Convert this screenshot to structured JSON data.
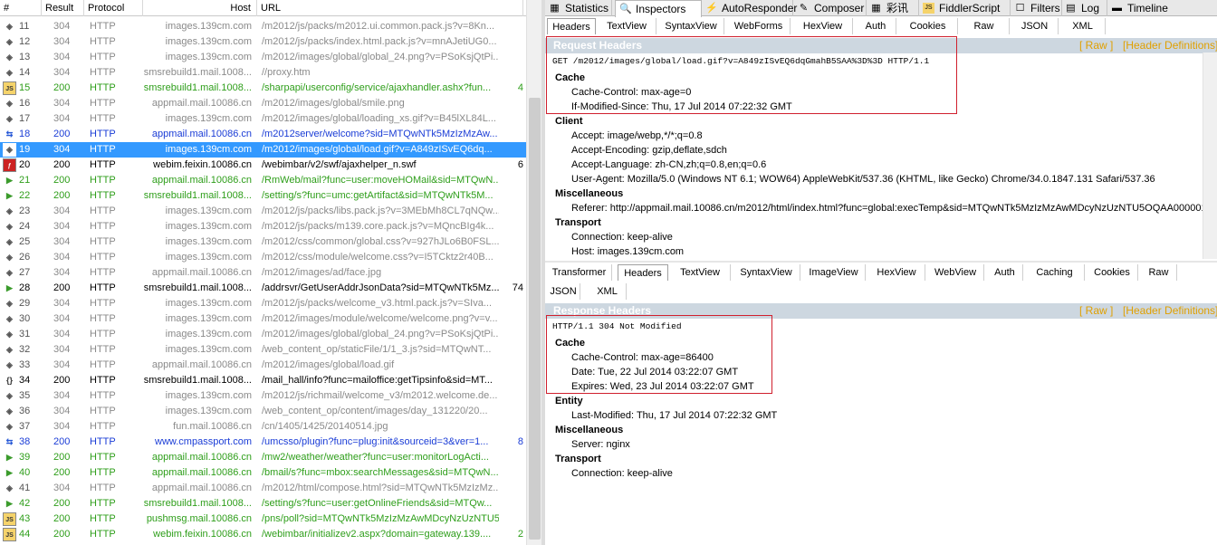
{
  "columns": {
    "num": "#",
    "result": "Result",
    "protocol": "Protocol",
    "host": "Host",
    "url": "URL"
  },
  "sessions": [
    {
      "icon": "img",
      "num": "11",
      "result": "304",
      "protocol": "HTTP",
      "host": "images.139cm.com",
      "url": "/m2012/js/packs/m2012.ui.common.pack.js?v=8Kn...",
      "size": "",
      "color": "gray"
    },
    {
      "icon": "img",
      "num": "12",
      "result": "304",
      "protocol": "HTTP",
      "host": "images.139cm.com",
      "url": "/m2012/js/packs/index.html.pack.js?v=mnAJetiUG0...",
      "size": "",
      "color": "gray"
    },
    {
      "icon": "img",
      "num": "13",
      "result": "304",
      "protocol": "HTTP",
      "host": "images.139cm.com",
      "url": "/m2012/images/global/global_24.png?v=PSoKsjQtPi...",
      "size": "",
      "color": "gray"
    },
    {
      "icon": "img",
      "num": "14",
      "result": "304",
      "protocol": "HTTP",
      "host": "smsrebuild1.mail.1008...",
      "url": "//proxy.htm",
      "size": "",
      "color": "gray"
    },
    {
      "icon": "js",
      "num": "15",
      "result": "200",
      "protocol": "HTTP",
      "host": "smsrebuild1.mail.1008...",
      "url": "/sharpapi/userconfig/service/ajaxhandler.ashx?fun...",
      "size": "4",
      "color": "green"
    },
    {
      "icon": "img",
      "num": "16",
      "result": "304",
      "protocol": "HTTP",
      "host": "appmail.mail.10086.cn",
      "url": "/m2012/images/global/smile.png",
      "size": "",
      "color": "gray"
    },
    {
      "icon": "img",
      "num": "17",
      "result": "304",
      "protocol": "HTTP",
      "host": "images.139cm.com",
      "url": "/m2012/images/global/loading_xs.gif?v=B45lXL84L...",
      "size": "",
      "color": "gray"
    },
    {
      "icon": "arrows",
      "num": "18",
      "result": "200",
      "protocol": "HTTP",
      "host": "appmail.mail.10086.cn",
      "url": "/m2012server/welcome?sid=MTQwNTk5MzIzMzAw...",
      "size": "",
      "color": "blue"
    },
    {
      "icon": "img",
      "num": "19",
      "result": "304",
      "protocol": "HTTP",
      "host": "images.139cm.com",
      "url": "/m2012/images/global/load.gif?v=A849zISvEQ6dq...",
      "size": "",
      "color": "gray",
      "selected": true
    },
    {
      "icon": "swf",
      "num": "20",
      "result": "200",
      "protocol": "HTTP",
      "host": "webim.feixin.10086.cn",
      "url": "/webimbar/v2/swf/ajaxhelper_n.swf",
      "size": "6",
      "color": "black"
    },
    {
      "icon": "post",
      "num": "21",
      "result": "200",
      "protocol": "HTTP",
      "host": "appmail.mail.10086.cn",
      "url": "/RmWeb/mail?func=user:moveHOMail&sid=MTQwN...",
      "size": "",
      "color": "green"
    },
    {
      "icon": "post",
      "num": "22",
      "result": "200",
      "protocol": "HTTP",
      "host": "smsrebuild1.mail.1008...",
      "url": "/setting/s?func=umc:getArtifact&sid=MTQwNTk5M...",
      "size": "",
      "color": "green"
    },
    {
      "icon": "img",
      "num": "23",
      "result": "304",
      "protocol": "HTTP",
      "host": "images.139cm.com",
      "url": "/m2012/js/packs/libs.pack.js?v=3MEbMh8CL7qNQw...",
      "size": "",
      "color": "gray"
    },
    {
      "icon": "img",
      "num": "24",
      "result": "304",
      "protocol": "HTTP",
      "host": "images.139cm.com",
      "url": "/m2012/js/packs/m139.core.pack.js?v=MQncBIg4k...",
      "size": "",
      "color": "gray"
    },
    {
      "icon": "img",
      "num": "25",
      "result": "304",
      "protocol": "HTTP",
      "host": "images.139cm.com",
      "url": "/m2012/css/common/global.css?v=927hJLo6B0FSL...",
      "size": "",
      "color": "gray"
    },
    {
      "icon": "img",
      "num": "26",
      "result": "304",
      "protocol": "HTTP",
      "host": "images.139cm.com",
      "url": "/m2012/css/module/welcome.css?v=I5TCktz2r40B...",
      "size": "",
      "color": "gray"
    },
    {
      "icon": "img",
      "num": "27",
      "result": "304",
      "protocol": "HTTP",
      "host": "appmail.mail.10086.cn",
      "url": "/m2012/images/ad/face.jpg",
      "size": "",
      "color": "gray"
    },
    {
      "icon": "post",
      "num": "28",
      "result": "200",
      "protocol": "HTTP",
      "host": "smsrebuild1.mail.1008...",
      "url": "/addrsvr/GetUserAddrJsonData?sid=MTQwNTk5Mz...",
      "size": "74",
      "color": "black"
    },
    {
      "icon": "img",
      "num": "29",
      "result": "304",
      "protocol": "HTTP",
      "host": "images.139cm.com",
      "url": "/m2012/js/packs/welcome_v3.html.pack.js?v=SIva...",
      "size": "",
      "color": "gray"
    },
    {
      "icon": "img",
      "num": "30",
      "result": "304",
      "protocol": "HTTP",
      "host": "images.139cm.com",
      "url": "/m2012/images/module/welcome/welcome.png?v=v...",
      "size": "",
      "color": "gray"
    },
    {
      "icon": "img",
      "num": "31",
      "result": "304",
      "protocol": "HTTP",
      "host": "images.139cm.com",
      "url": "/m2012/images/global/global_24.png?v=PSoKsjQtPi...",
      "size": "",
      "color": "gray"
    },
    {
      "icon": "img",
      "num": "32",
      "result": "304",
      "protocol": "HTTP",
      "host": "images.139cm.com",
      "url": "/web_content_op/staticFile/1/1_3.js?sid=MTQwNT...",
      "size": "",
      "color": "gray"
    },
    {
      "icon": "img",
      "num": "33",
      "result": "304",
      "protocol": "HTTP",
      "host": "appmail.mail.10086.cn",
      "url": "/m2012/images/global/load.gif",
      "size": "",
      "color": "gray"
    },
    {
      "icon": "json",
      "num": "34",
      "result": "200",
      "protocol": "HTTP",
      "host": "smsrebuild1.mail.1008...",
      "url": "/mail_hall/info?func=mailoffice:getTipsinfo&sid=MT...",
      "size": "",
      "color": "black"
    },
    {
      "icon": "img",
      "num": "35",
      "result": "304",
      "protocol": "HTTP",
      "host": "images.139cm.com",
      "url": "/m2012/js/richmail/welcome_v3/m2012.welcome.de...",
      "size": "",
      "color": "gray"
    },
    {
      "icon": "img",
      "num": "36",
      "result": "304",
      "protocol": "HTTP",
      "host": "images.139cm.com",
      "url": "/web_content_op/content/images/day_131220/20...",
      "size": "",
      "color": "gray"
    },
    {
      "icon": "img",
      "num": "37",
      "result": "304",
      "protocol": "HTTP",
      "host": "fun.mail.10086.cn",
      "url": "/cn/1405/1425/20140514.jpg",
      "size": "",
      "color": "gray"
    },
    {
      "icon": "arrows",
      "num": "38",
      "result": "200",
      "protocol": "HTTP",
      "host": "www.cmpassport.com",
      "url": "/umcsso/plugin?func=plug:init&sourceid=3&ver=1...",
      "size": "8",
      "color": "blue"
    },
    {
      "icon": "post",
      "num": "39",
      "result": "200",
      "protocol": "HTTP",
      "host": "appmail.mail.10086.cn",
      "url": "/mw2/weather/weather?func=user:monitorLogActi...",
      "size": "",
      "color": "green"
    },
    {
      "icon": "post",
      "num": "40",
      "result": "200",
      "protocol": "HTTP",
      "host": "appmail.mail.10086.cn",
      "url": "/bmail/s?func=mbox:searchMessages&sid=MTQwN...",
      "size": "",
      "color": "green"
    },
    {
      "icon": "img",
      "num": "41",
      "result": "304",
      "protocol": "HTTP",
      "host": "appmail.mail.10086.cn",
      "url": "/m2012/html/compose.html?sid=MTQwNTk5MzIzMz...",
      "size": "",
      "color": "gray"
    },
    {
      "icon": "post",
      "num": "42",
      "result": "200",
      "protocol": "HTTP",
      "host": "smsrebuild1.mail.1008...",
      "url": "/setting/s?func=user:getOnlineFriends&sid=MTQw...",
      "size": "",
      "color": "green"
    },
    {
      "icon": "js",
      "num": "43",
      "result": "200",
      "protocol": "HTTP",
      "host": "pushmsg.mail.10086.cn",
      "url": "/pns/poll?sid=MTQwNTk5MzIzMzAwMDcyNzUzNTU5...",
      "size": "",
      "color": "green"
    },
    {
      "icon": "js",
      "num": "44",
      "result": "200",
      "protocol": "HTTP",
      "host": "webim.feixin.10086.cn",
      "url": "/webimbar/initializev2.aspx?domain=gateway.139....",
      "size": "2",
      "color": "green"
    }
  ],
  "toptabs": [
    {
      "label": "Statistics",
      "icon": "chart-icon"
    },
    {
      "label": "Inspectors",
      "icon": "inspect-icon",
      "active": true
    },
    {
      "label": "AutoResponder",
      "icon": "lightning-icon"
    },
    {
      "label": "Composer",
      "icon": "pencil-icon"
    },
    {
      "label": "彩讯科技",
      "icon": "grid-icon"
    },
    {
      "label": "FiddlerScript",
      "icon": "script-icon"
    },
    {
      "label": "Filters",
      "icon": "checkbox-icon"
    },
    {
      "label": "Log",
      "icon": "log-icon"
    },
    {
      "label": "Timeline",
      "icon": "timeline-icon"
    }
  ],
  "request_tabs": [
    "Headers",
    "TextView",
    "SyntaxView",
    "WebForms",
    "HexView",
    "Auth",
    "Cookies",
    "Raw",
    "JSON",
    "XML"
  ],
  "request": {
    "title": "Request Headers",
    "raw_link": "[ Raw ]",
    "def_link": "[Header Definitions]",
    "line": "GET /m2012/images/global/load.gif?v=A849zISvEQ6dqGmahB5SAA%3D%3D HTTP/1.1",
    "groups": [
      {
        "name": "Cache",
        "items": [
          "Cache-Control: max-age=0",
          "If-Modified-Since: Thu, 17 Jul 2014 07:22:32 GMT"
        ]
      },
      {
        "name": "Client",
        "items": [
          "Accept: image/webp,*/*;q=0.8",
          "Accept-Encoding: gzip,deflate,sdch",
          "Accept-Language: zh-CN,zh;q=0.8,en;q=0.6",
          "User-Agent: Mozilla/5.0 (Windows NT 6.1; WOW64) AppleWebKit/537.36 (KHTML, like Gecko) Chrome/34.0.1847.131 Safari/537.36"
        ]
      },
      {
        "name": "Miscellaneous",
        "items": [
          "Referer: http://appmail.mail.10086.cn/m2012/html/index.html?func=global:execTemp&sid=MTQwNTk5MzIzMzAwMDcyNzUzNTU5OQAA000001"
        ]
      },
      {
        "name": "Transport",
        "items": [
          "Connection: keep-alive",
          "Host: images.139cm.com"
        ]
      }
    ]
  },
  "response_tabs_row1": [
    "Transformer",
    "Headers",
    "TextView",
    "SyntaxView",
    "ImageView",
    "HexView",
    "WebView",
    "Auth",
    "Caching",
    "Cookies",
    "Raw"
  ],
  "response_tabs_row2": [
    "JSON",
    "XML"
  ],
  "response": {
    "title": "Response Headers",
    "raw_link": "[ Raw ]",
    "def_link": "[Header Definitions]",
    "line": "HTTP/1.1 304 Not Modified",
    "groups": [
      {
        "name": "Cache",
        "items": [
          "Cache-Control: max-age=86400",
          "Date: Tue, 22 Jul 2014 03:22:07 GMT",
          "Expires: Wed, 23 Jul 2014 03:22:07 GMT"
        ]
      },
      {
        "name": "Entity",
        "items": [
          "Last-Modified: Thu, 17 Jul 2014 07:22:32 GMT"
        ]
      },
      {
        "name": "Miscellaneous",
        "items": [
          "Server: nginx"
        ]
      },
      {
        "name": "Transport",
        "items": [
          "Connection: keep-alive"
        ]
      }
    ]
  },
  "colors": {
    "gray": "#8a8a8a",
    "green": "#2e9e1a",
    "blue": "#1a3cd6",
    "black": "#000000",
    "selected": "#3399ff",
    "highlight_box": "#d0202e",
    "header_bar": "#cdd7e0",
    "link": "#e0a000"
  }
}
